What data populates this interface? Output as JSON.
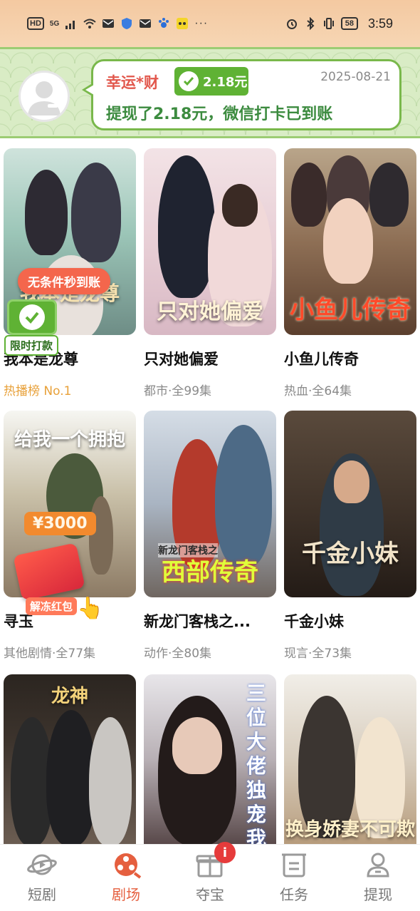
{
  "status_bar": {
    "network_chip": "HD",
    "network_gen": "5G",
    "battery": "58",
    "time": "3:59",
    "more": "···"
  },
  "notification": {
    "user": "幸运*财",
    "amount": "2.18元",
    "date": "2025-08-21",
    "message": "提现了2.18元，微信打卡已到账",
    "accent_color": "#5fb234",
    "user_color": "#e2574c"
  },
  "dramas": [
    {
      "title": "我本是龙尊",
      "meta": "热播榜 No.1",
      "poster_text": "我本是龙尊"
    },
    {
      "title": "只对她偏爱",
      "meta": "都市·全99集",
      "poster_text": "只对她偏爱"
    },
    {
      "title": "小鱼儿传奇",
      "meta": "热血·全64集",
      "poster_text": "小鱼儿传奇"
    },
    {
      "title": "寻玉",
      "meta": "其他剧情·全77集",
      "poster_text": "给我一个拥抱"
    },
    {
      "title": "新龙门客栈之...",
      "meta": "动作·全80集",
      "poster_text": "西部传奇",
      "poster_subtext": "新龙门客栈之"
    },
    {
      "title": "千金小妹",
      "meta": "现言·全73集",
      "poster_text": "千金小妹"
    },
    {
      "title": "",
      "meta": "",
      "poster_text": "龙神"
    },
    {
      "title": "",
      "meta": "",
      "poster_text": "三位大佬独宠我"
    },
    {
      "title": "",
      "meta": "",
      "poster_text": "换身娇妻不可欺"
    }
  ],
  "overlays": {
    "promo_pill": "无条件秒到账",
    "checkin_label": "限时打款",
    "reward_amount": "¥3000",
    "redpack_label": "解冻红包"
  },
  "bottom_nav": [
    {
      "label": "短剧",
      "icon": "planet-icon",
      "active": false
    },
    {
      "label": "剧场",
      "icon": "film-reel-icon",
      "active": true
    },
    {
      "label": "夺宝",
      "icon": "gift-icon",
      "active": false,
      "badge": "i"
    },
    {
      "label": "任务",
      "icon": "task-icon",
      "active": false
    },
    {
      "label": "提现",
      "icon": "user-icon",
      "active": false
    }
  ],
  "colors": {
    "active_tab": "#e55f3f",
    "hot_meta": "#e8a13a",
    "banner_bg": "#d9ecc5"
  }
}
